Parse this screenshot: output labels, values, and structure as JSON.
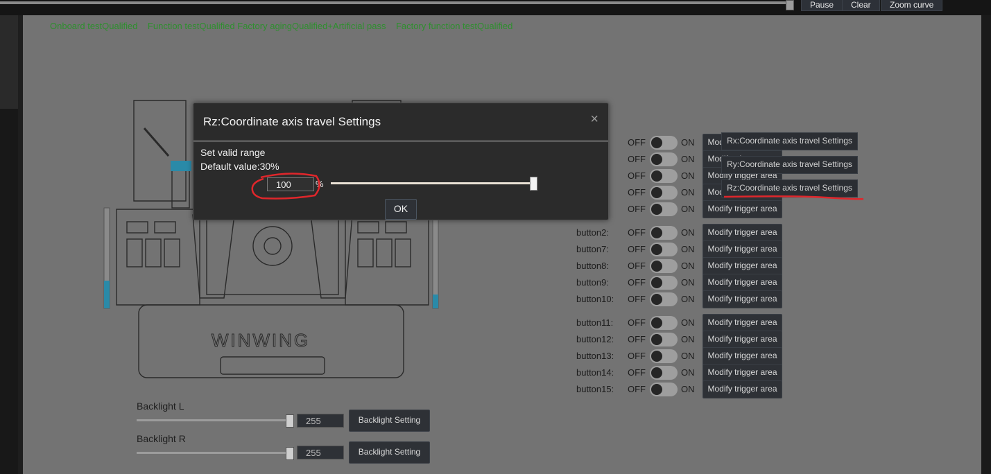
{
  "topbar": {
    "pause": "Pause",
    "clear": "Clear",
    "zoom": "Zoom curve"
  },
  "status": "Onboard testQualified    Function testQualified Factory agingQualified+Artificial pass    Factory function testQualified",
  "device": {
    "logo": "WINWING"
  },
  "button_rows": [
    {
      "label": "",
      "off": "OFF",
      "on": "ON",
      "action": "Modify trigger area"
    },
    {
      "label": "",
      "off": "OFF",
      "on": "ON",
      "action": "Modify trigger area"
    },
    {
      "label": "",
      "off": "OFF",
      "on": "ON",
      "action": "Modify trigger area"
    },
    {
      "label": "",
      "off": "OFF",
      "on": "ON",
      "action": "Modify trigger area"
    },
    {
      "label": "",
      "off": "OFF",
      "on": "ON",
      "action": "Modify trigger area"
    },
    {
      "label": "button2:",
      "off": "OFF",
      "on": "ON",
      "action": "Modify trigger area"
    },
    {
      "label": "button7:",
      "off": "OFF",
      "on": "ON",
      "action": "Modify trigger area"
    },
    {
      "label": "button8:",
      "off": "OFF",
      "on": "ON",
      "action": "Modify trigger area"
    },
    {
      "label": "button9:",
      "off": "OFF",
      "on": "ON",
      "action": "Modify trigger area"
    },
    {
      "label": "button10:",
      "off": "OFF",
      "on": "ON",
      "action": "Modify trigger area"
    },
    {
      "label": "button11:",
      "off": "OFF",
      "on": "ON",
      "action": "Modify trigger area"
    },
    {
      "label": "button12:",
      "off": "OFF",
      "on": "ON",
      "action": "Modify trigger area"
    },
    {
      "label": "button13:",
      "off": "OFF",
      "on": "ON",
      "action": "Modify trigger area"
    },
    {
      "label": "button14:",
      "off": "OFF",
      "on": "ON",
      "action": "Modify trigger area"
    },
    {
      "label": "button15:",
      "off": "OFF",
      "on": "ON",
      "action": "Modify trigger area"
    }
  ],
  "tooltips": [
    "Rx:Coordinate axis travel Settings",
    "Ry:Coordinate axis travel Settings",
    "Rz:Coordinate axis travel Settings"
  ],
  "backlight": [
    {
      "label": "Backlight L",
      "value": "255",
      "button": "Backlight Setting"
    },
    {
      "label": "Backlight R",
      "value": "255",
      "button": "Backlight Setting"
    }
  ],
  "modal": {
    "title": "Rz:Coordinate axis travel Settings",
    "close": "×",
    "line1": "Set valid range",
    "line2": "Default value:30%",
    "value": "100",
    "unit": "%",
    "slider_fraction": 1.0,
    "ok": "OK"
  },
  "colors": {
    "status_green": "#2e8f2e",
    "annotation_red": "#e0262b",
    "device_accent": "#2a8aa8"
  }
}
